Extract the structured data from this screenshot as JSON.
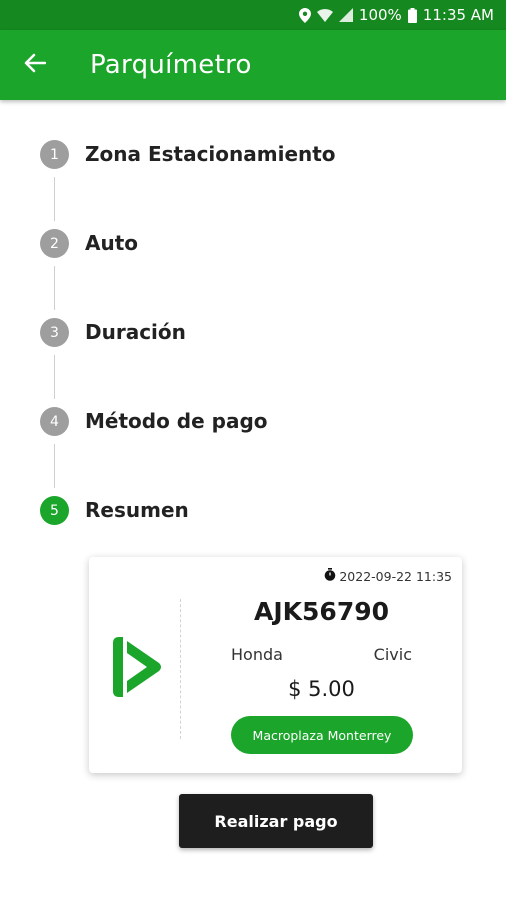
{
  "status_bar": {
    "battery": "100%",
    "time": "11:35 AM",
    "icons": [
      "location-icon",
      "wifi-icon",
      "signal-icon",
      "battery-icon"
    ]
  },
  "app_bar": {
    "title": "Parquímetro",
    "back_icon": "arrow-left-icon"
  },
  "stepper": {
    "steps": [
      {
        "number": "1",
        "label": "Zona Estacionamiento",
        "active": false
      },
      {
        "number": "2",
        "label": "Auto",
        "active": false
      },
      {
        "number": "3",
        "label": "Duración",
        "active": false
      },
      {
        "number": "4",
        "label": "Método de pago",
        "active": false
      },
      {
        "number": "5",
        "label": "Resumen",
        "active": true
      }
    ]
  },
  "summary": {
    "timestamp": "2022-09-22 11:35",
    "plate": "AJK56790",
    "make": "Honda",
    "model": "Civic",
    "price": "$ 5.00",
    "zone": "Macroplaza Monterrey"
  },
  "actions": {
    "pay_label": "Realizar pago"
  },
  "colors": {
    "primary": "#1ba52a",
    "status_bar": "#15881f",
    "step_inactive": "#9e9e9e",
    "button_dark": "#1e1e1e"
  }
}
